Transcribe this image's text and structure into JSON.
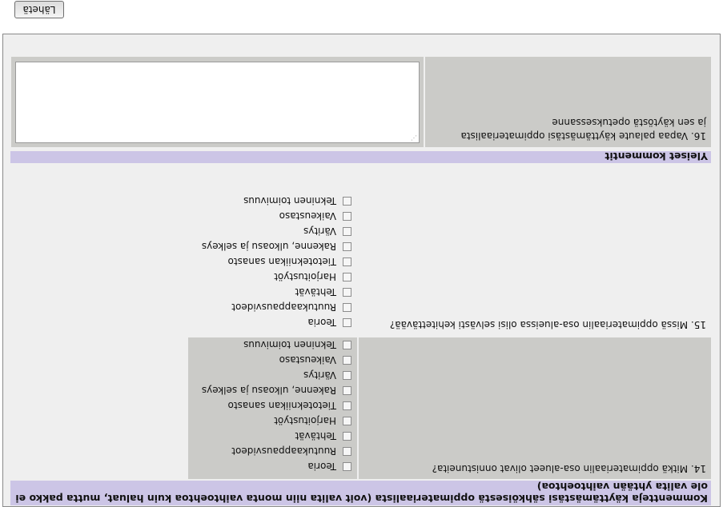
{
  "submit_label": "Lähetä",
  "section_comments": {
    "header": "Kommentteja käyttämästäsi sähköisestä oppimateriaalista (voit valita niin monta vaihtoehtoa kuin haluat, mutta pakko ei ole valita yhtään vaihtoehtoa)"
  },
  "q14": {
    "label": "14. Mitkä oppimateriaalin osa-alueet olivat onnistuneita?",
    "options": [
      "Teoria",
      "Ruutukaappausvideot",
      "Tehtävät",
      "Harjoitustyöt",
      "Tietotekniikan sanasto",
      "Rakenne, ulkoasu ja selkeys",
      "Väritys",
      "Vaikeustaso",
      "Tekninen toimivuus"
    ]
  },
  "q15": {
    "label": "15. Missä oppimateriaalin osa-alueissa olisi selvästi kehitettävää?",
    "options": [
      "Teoria",
      "Ruutukaappausvideot",
      "Tehtävät",
      "Harjoitustyöt",
      "Tietotekniikan sanasto",
      "Rakenne, ulkoasu ja selkeys",
      "Väritys",
      "Vaikeustaso",
      "Tekninen toimivuus"
    ]
  },
  "section_general": {
    "header": "Yleiset kommentit"
  },
  "q16": {
    "label_line1": "16. Vapaa palaute käyttämästäsi oppimateriaalista",
    "label_line2": "ja sen käytöstä opetuksessanne"
  }
}
